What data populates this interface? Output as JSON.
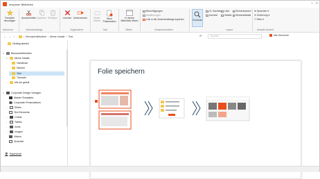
{
  "window": {
    "title": "empower Bibliothek",
    "controls": [
      "–",
      "□"
    ]
  },
  "ribbon": {
    "neu": {
      "label1": "Favoriten",
      "label2": "hinzufügen",
      "group": "Neu/neue"
    },
    "zwischenablage": {
      "ausschneiden": "Ausschneiden",
      "kopieren": "Kopieren",
      "einfuegen": "Einfügen",
      "group": "Zwischenablage"
    },
    "organisieren": {
      "loeschen": "Löschen",
      "umbenennen": "Umbenennen",
      "group": "Organisieren"
    },
    "neu2": {
      "neuer_ordner": "Neuer Ordner",
      "neue_praesentation": "Neue Präsentation",
      "group": "Neu"
    },
    "oeffnen": {
      "in_neuem": "In neuem Bibliothek öffnen",
      "group": "Öffnen"
    },
    "zusammenstellen": {
      "berechtigungen": "Berechtigungen",
      "markierungen": "Markierungen",
      "link": "Link in die Zwischenablage kopieren",
      "group": "Zusammenstellen"
    },
    "layout": {
      "vorschau": "Vorschau",
      "kacheln_xl": "XL Kacheln",
      "kacheln": "Kacheln",
      "liste": "Liste",
      "details": "Details",
      "elementnamen": "Elementnamen",
      "elementdetails": "Elementdetails",
      "group": "Layout"
    },
    "ansicht": {
      "sprachen": "Sprachen",
      "sortierung": "Sortierung",
      "filter": "Filter",
      "group": "Aktuelle Ansicht"
    }
  },
  "address": {
    "breadcrumb": [
      "Benutzerbibliothek",
      "Meine Inhalte",
      "Test"
    ],
    "search_placeholder": "Suchen",
    "alle_elemente": "Alle Elemente"
  },
  "sidebar": {
    "getting_started": "Getting started",
    "benutzerbibliothek": "Benutzerbibliothek",
    "meine_inhalte": "Meine Inhalte",
    "handbuch": "Handbuch",
    "manuel": "Manuel",
    "test": "Test",
    "tutorials": "Tutorials",
    "mit_mir_geteilt": "Mit mir geteilt",
    "corporate": "Corporate Design Vorlagen",
    "master_templates": "Master Templates",
    "corporate_presentations": "Corporate Presentations",
    "slides": "Slides",
    "text_elements": "Text Elements",
    "charts": "Charts",
    "tables": "Tables",
    "icons": "Icons",
    "images": "Images",
    "videos": "Videos",
    "smartart": "SmartArt",
    "papierkorb": "Papierkorb"
  },
  "slide": {
    "title": "Folie speichern"
  },
  "colors": {
    "brand": "#e94e1b",
    "folder": "#f2c84b",
    "selection": "#cce4f7"
  }
}
